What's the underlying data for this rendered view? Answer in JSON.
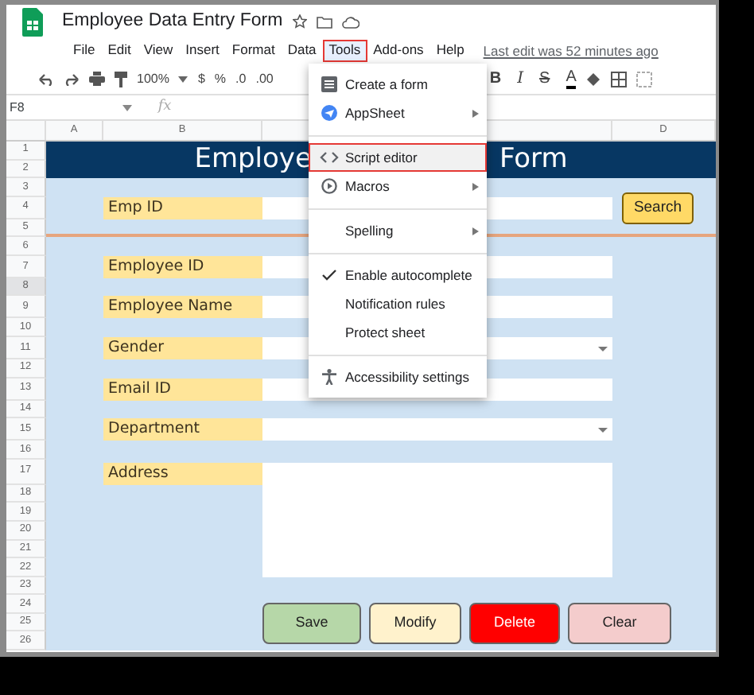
{
  "app": {
    "title": "Employee Data Entry Form"
  },
  "menu_bar": [
    {
      "label": "File",
      "selected": false
    },
    {
      "label": "Edit",
      "selected": false
    },
    {
      "label": "View",
      "selected": false
    },
    {
      "label": "Insert",
      "selected": false
    },
    {
      "label": "Format",
      "selected": false
    },
    {
      "label": "Data",
      "selected": false
    },
    {
      "label": "Tools",
      "selected": true
    },
    {
      "label": "Add-ons",
      "selected": false
    },
    {
      "label": "Help",
      "selected": false
    }
  ],
  "last_edit": "Last edit was 52 minutes ago",
  "toolbar": {
    "zoom": "100%",
    "currency": "$",
    "percent": "%",
    "decrease_decimals": ".0",
    "increase_decimals": ".00",
    "format_buttons": [
      "B",
      "I",
      "S",
      "A"
    ]
  },
  "name_box": "F8",
  "formula_label": "fx",
  "column_headers": [
    "A",
    "B",
    "D"
  ],
  "rows": [
    {
      "label": "1",
      "selected": false
    },
    {
      "label": "2",
      "selected": false
    },
    {
      "label": "3",
      "selected": false
    },
    {
      "label": "4",
      "selected": false
    },
    {
      "label": "5",
      "selected": false
    },
    {
      "label": "6",
      "selected": false
    },
    {
      "label": "7",
      "selected": false
    },
    {
      "label": "8",
      "selected": true
    },
    {
      "label": "9",
      "selected": false
    },
    {
      "label": "10",
      "selected": false
    },
    {
      "label": "11",
      "selected": false
    },
    {
      "label": "12",
      "selected": false
    },
    {
      "label": "13",
      "selected": false
    },
    {
      "label": "14",
      "selected": false
    },
    {
      "label": "15",
      "selected": false
    },
    {
      "label": "16",
      "selected": false
    },
    {
      "label": "17",
      "selected": false
    },
    {
      "label": "18",
      "selected": false
    },
    {
      "label": "19",
      "selected": false
    },
    {
      "label": "20",
      "selected": false
    },
    {
      "label": "21",
      "selected": false
    },
    {
      "label": "22",
      "selected": false
    },
    {
      "label": "23",
      "selected": false
    },
    {
      "label": "24",
      "selected": false
    },
    {
      "label": "25",
      "selected": false
    },
    {
      "label": "26",
      "selected": false
    }
  ],
  "form": {
    "title_parts": [
      "Employe",
      "Form"
    ],
    "search_label": "Emp ID",
    "search_button": "Search",
    "fields": [
      {
        "label": "Employee ID",
        "kind": "text"
      },
      {
        "label": "Employee Name",
        "kind": "text"
      },
      {
        "label": "Gender",
        "kind": "dropdown"
      },
      {
        "label": "Email ID",
        "kind": "text"
      },
      {
        "label": "Department",
        "kind": "dropdown"
      },
      {
        "label": "Address",
        "kind": "textarea"
      }
    ],
    "buttons": [
      {
        "label": "Save",
        "color": "#b6d7a8"
      },
      {
        "label": "Modify",
        "color": "#fff2cc"
      },
      {
        "label": "Delete",
        "color": "#ff0000"
      },
      {
        "label": "Clear",
        "color": "#f4cccc"
      }
    ]
  },
  "tools_menu": [
    {
      "kind": "item",
      "label": "Create a form",
      "submenu": false,
      "checked": false,
      "selected": false
    },
    {
      "kind": "item",
      "label": "AppSheet",
      "submenu": true,
      "checked": false,
      "selected": false
    },
    {
      "kind": "separator"
    },
    {
      "kind": "item",
      "label": "Script editor",
      "submenu": false,
      "checked": false,
      "selected": true
    },
    {
      "kind": "item",
      "label": "Macros",
      "submenu": true,
      "checked": false,
      "selected": false
    },
    {
      "kind": "separator"
    },
    {
      "kind": "item",
      "label": "Spelling",
      "submenu": true,
      "checked": false,
      "selected": false
    },
    {
      "kind": "separator"
    },
    {
      "kind": "item",
      "label": "Enable autocomplete",
      "submenu": false,
      "checked": true,
      "selected": false
    },
    {
      "kind": "item",
      "label": "Notification rules",
      "submenu": false,
      "checked": false,
      "selected": false
    },
    {
      "kind": "item",
      "label": "Protect sheet",
      "submenu": false,
      "checked": false,
      "selected": false
    },
    {
      "kind": "separator"
    },
    {
      "kind": "item",
      "label": "Accessibility settings",
      "submenu": false,
      "checked": false,
      "selected": false
    }
  ]
}
